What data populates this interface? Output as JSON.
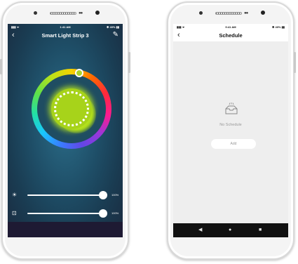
{
  "left_phone": {
    "status": {
      "signal": "▮▮▮ ᯤ",
      "time": "1:41 AM",
      "battery": "✱ 40% ▮▮"
    },
    "title": "Smart Light Strip 3",
    "brightness": {
      "icon": "sun-icon",
      "value_label": "100%",
      "level": 1.0
    },
    "temperature": {
      "icon": "temperature-icon",
      "value_label": "100%",
      "level": 1.0
    },
    "selected_color": "#a7d31a"
  },
  "right_phone": {
    "status": {
      "signal": "▮▮▮ ᯤ",
      "time": "9:41 AM",
      "battery": "✱ 40% ▮▮"
    },
    "title": "Schedule",
    "empty_text": "No Schedule",
    "add_label": "Add",
    "nav": {
      "back": "◀",
      "home": "●",
      "recents": "■"
    }
  }
}
